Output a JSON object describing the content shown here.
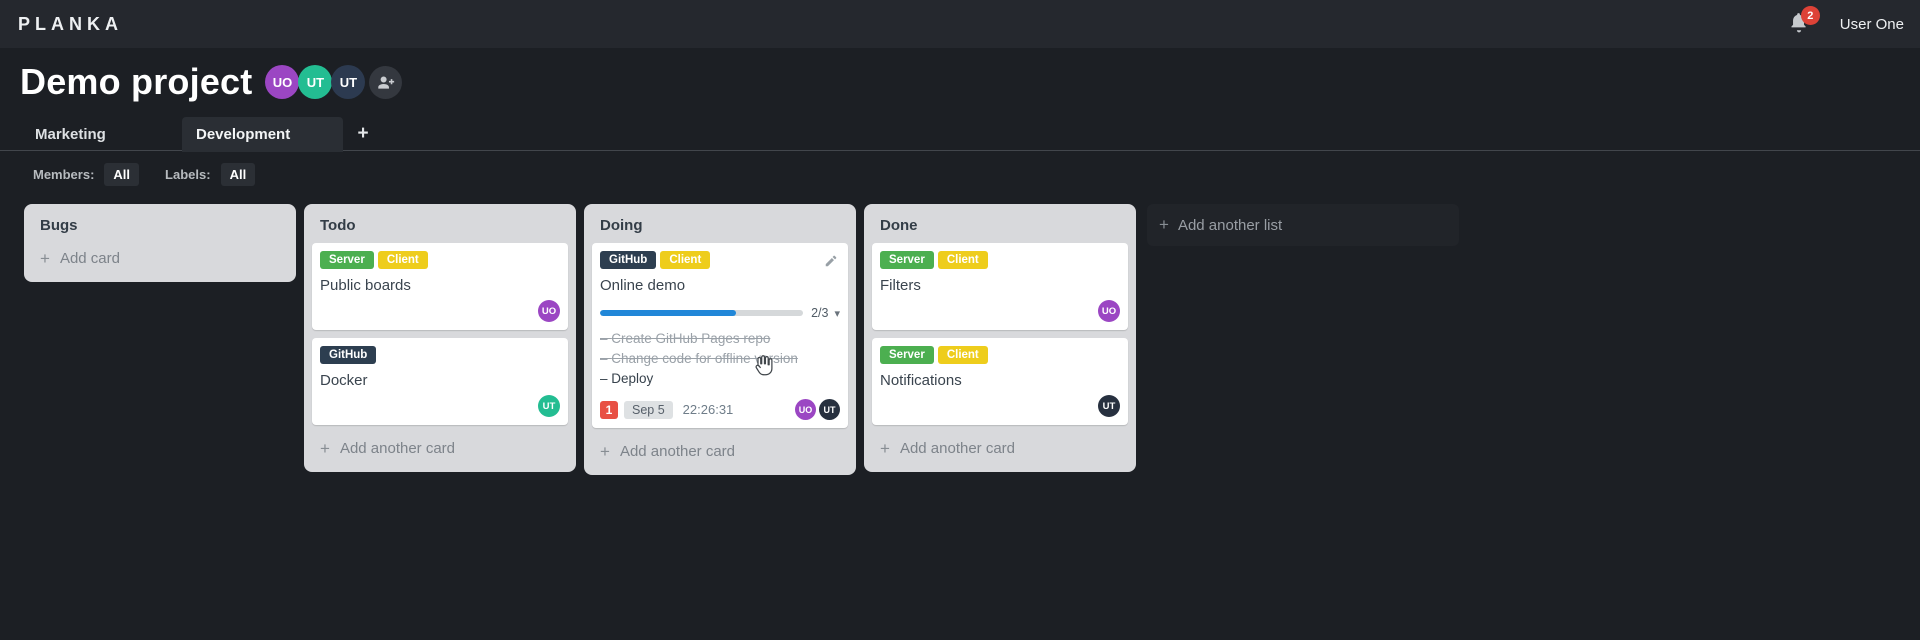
{
  "topbar": {
    "logo": "PLANKA",
    "notification_count": "2",
    "user_name": "User One"
  },
  "header": {
    "title": "Demo project",
    "members": [
      {
        "initials": "UO"
      },
      {
        "initials": "UT"
      },
      {
        "initials": "UT"
      }
    ]
  },
  "tabs": {
    "items": [
      {
        "label": "Marketing",
        "selected": false
      },
      {
        "label": "Development",
        "selected": true
      }
    ],
    "add_label": "+"
  },
  "filters": {
    "members_label": "Members:",
    "members_value": "All",
    "labels_label": "Labels:",
    "labels_value": "All"
  },
  "board": {
    "add_list_label": "Add another list",
    "lists": [
      {
        "title": "Bugs",
        "add_label": "Add card",
        "cards": []
      },
      {
        "title": "Todo",
        "add_label": "Add another card",
        "cards": [
          {
            "title": "Public boards",
            "labels": [
              {
                "name": "Server"
              },
              {
                "name": "Client"
              }
            ],
            "members": [
              {
                "initials": "UO"
              }
            ]
          },
          {
            "title": "Docker",
            "labels": [
              {
                "name": "GitHub"
              }
            ],
            "members": [
              {
                "initials": "UT"
              }
            ]
          }
        ]
      },
      {
        "title": "Doing",
        "add_label": "Add another card",
        "cards": [
          {
            "title": "Online demo",
            "labels": [
              {
                "name": "GitHub"
              },
              {
                "name": "Client"
              }
            ],
            "progress": {
              "completed": 2,
              "total": 3,
              "text": "2/3",
              "percent": 67
            },
            "tasks": [
              {
                "text": "Create GitHub Pages repo",
                "done": true
              },
              {
                "text": "Change code for offline version",
                "done": true
              },
              {
                "text": "Deploy",
                "done": false
              }
            ],
            "notification_count": "1",
            "due_date": "Sep 5",
            "timer": "22:26:31",
            "members": [
              {
                "initials": "UO"
              },
              {
                "initials": "UT"
              }
            ]
          }
        ]
      },
      {
        "title": "Done",
        "add_label": "Add another card",
        "cards": [
          {
            "title": "Filters",
            "labels": [
              {
                "name": "Server"
              },
              {
                "name": "Client"
              }
            ],
            "members": [
              {
                "initials": "UO"
              }
            ]
          },
          {
            "title": "Notifications",
            "labels": [
              {
                "name": "Server"
              },
              {
                "name": "Client"
              }
            ],
            "members": [
              {
                "initials": "UT"
              }
            ]
          }
        ]
      }
    ]
  },
  "colors": {
    "topbar_bg": "#25282e",
    "page_bg": "#1c1f24",
    "label_server": "#4caf50",
    "label_client": "#eecd1c",
    "label_github": "#2d3e50",
    "progress_blue": "#2187d8",
    "due_badge_red": "#e85044",
    "notification_badge_red": "#dd4237",
    "avatar_purple": "#9b46c3",
    "avatar_teal": "#23bd92",
    "avatar_navy": "#2c3a50"
  }
}
